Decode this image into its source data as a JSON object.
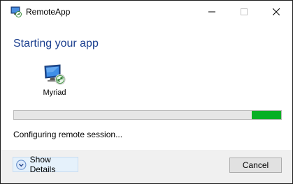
{
  "window": {
    "title": "RemoteApp",
    "icon": "remoteapp-icon",
    "controls": [
      "minimize-icon",
      "maximize-icon",
      "close-icon"
    ]
  },
  "main": {
    "heading": "Starting your app",
    "app": {
      "name": "Myriad",
      "icon": "remote-monitor-icon"
    },
    "progress": {
      "value_fraction": 0.11,
      "position": "right-end",
      "color": "#06b025",
      "track_color": "#e6e6e6"
    },
    "status": "Configuring remote session..."
  },
  "footer": {
    "show_details_label": "Show Details",
    "show_details_icon": "chevron-down-circle-icon",
    "cancel_label": "Cancel"
  },
  "colors": {
    "heading": "#1b3f8f",
    "footer_bg": "#f0f0f0",
    "details_bg": "#e5f1fb"
  }
}
